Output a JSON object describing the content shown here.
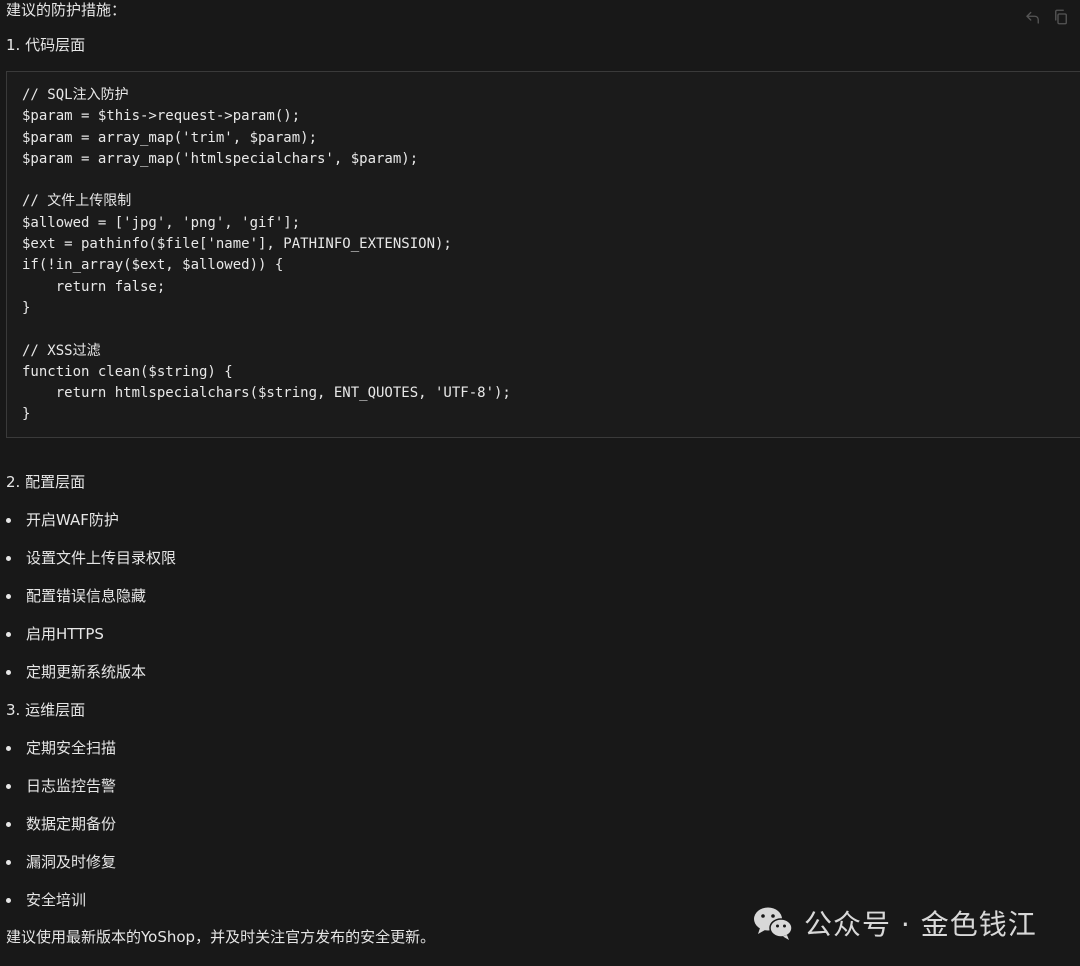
{
  "header": {
    "intro": "建议的防护措施："
  },
  "sections": {
    "code_title": "1. 代码层面",
    "config_title": "2. 配置层面",
    "ops_title": "3. 运维层面"
  },
  "code_lines": [
    "// SQL注入防护",
    "$param = $this->request->param();",
    "$param = array_map('trim', $param);",
    "$param = array_map('htmlspecialchars', $param);",
    "",
    "// 文件上传限制",
    "$allowed = ['jpg', 'png', 'gif'];",
    "$ext = pathinfo($file['name'], PATHINFO_EXTENSION);",
    "if(!in_array($ext, $allowed)) {",
    "    return false;",
    "}",
    "",
    "// XSS过滤",
    "function clean($string) {",
    "    return htmlspecialchars($string, ENT_QUOTES, 'UTF-8');",
    "}"
  ],
  "config_items": [
    "开启WAF防护",
    "设置文件上传目录权限",
    "配置错误信息隐藏",
    "启用HTTPS",
    "定期更新系统版本"
  ],
  "ops_items": [
    "定期安全扫描",
    "日志监控告警",
    "数据定期备份",
    "漏洞及时修复",
    "安全培训"
  ],
  "footer": {
    "summary": "建议使用最新版本的YoShop，并及时关注官方发布的安全更新。"
  },
  "watermark": {
    "text": "公众号 · 金色钱江"
  },
  "icons": {
    "undo": "undo-icon",
    "copy": "copy-icon",
    "wechat": "wechat-icon"
  },
  "colors": {
    "background": "#181818",
    "code_background": "#1b1b1b",
    "border": "#3a3a3a",
    "text": "#e6e6e6"
  }
}
